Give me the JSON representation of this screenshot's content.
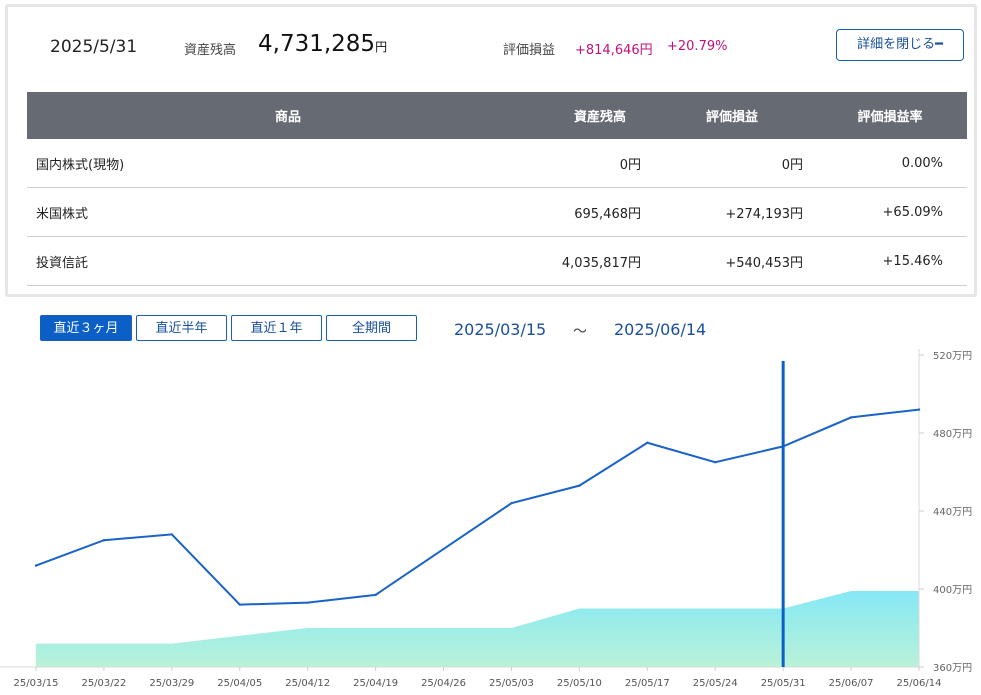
{
  "summary": {
    "date": "2025/5/31",
    "balance_label": "資産残高",
    "balance_value": "4,731,285",
    "balance_unit": "円",
    "pl_label": "評価損益",
    "pl_value": "+814,646円",
    "pl_rate": "+20.79%",
    "close_button": "詳細を閉じる━"
  },
  "table": {
    "headers": [
      "商品",
      "資産残高",
      "評価損益",
      "評価損益率"
    ],
    "rows": [
      {
        "name": "国内株式(現物)",
        "balance": "0円",
        "pl": "0円",
        "rate": "0.00%"
      },
      {
        "name": "米国株式",
        "balance": "695,468円",
        "pl": "+274,193円",
        "rate": "+65.09%"
      },
      {
        "name": "投資信託",
        "balance": "4,035,817円",
        "pl": "+540,453円",
        "rate": "+15.46%"
      }
    ]
  },
  "period": {
    "tabs": [
      "直近３ヶ月",
      "直近半年",
      "直近１年",
      "全期間"
    ],
    "active": 0,
    "from": "2025/03/15",
    "separator": "～",
    "to": "2025/06/14"
  },
  "chart_data": {
    "type": "line",
    "x": [
      "25/03/15",
      "25/03/22",
      "25/03/29",
      "25/04/05",
      "25/04/12",
      "25/04/19",
      "25/04/26",
      "25/05/03",
      "25/05/10",
      "25/05/17",
      "25/05/24",
      "25/05/31",
      "25/06/07",
      "25/06/14"
    ],
    "x_tick_labels": [
      "25/03/15",
      "25/03/22",
      "25/03/29",
      "25/04/05",
      "25/04/12",
      "25/04/19",
      "25/04/26",
      "25/05/03",
      "25/05/10",
      "25/05/17",
      "25/05/24",
      "25/05/31",
      "25/06/07",
      "25/06/14"
    ],
    "series": [
      {
        "kind": "line",
        "values": [
          4120000,
          4250000,
          4280000,
          3920000,
          3930000,
          3970000,
          null,
          4440000,
          4530000,
          4750000,
          4650000,
          4731285,
          4880000,
          4920000
        ],
        "color": "#1a63c7"
      },
      {
        "kind": "area",
        "values": [
          3720000,
          3720000,
          3720000,
          3760000,
          3800000,
          3800000,
          3800000,
          3800000,
          3900000,
          3900000,
          3900000,
          3900000,
          3990000,
          3990000
        ],
        "color": "#7be8f0"
      }
    ],
    "y_ticks": [
      3600000,
      4000000,
      4400000,
      4800000,
      5200000
    ],
    "y_tick_labels": [
      "360万円",
      "400万円",
      "440万円",
      "480万円",
      "520万円"
    ],
    "ylim": [
      3600000,
      5200000
    ],
    "grid": false,
    "highlight_x": "25/05/31",
    "highlight_color": "#0b5fc7"
  }
}
